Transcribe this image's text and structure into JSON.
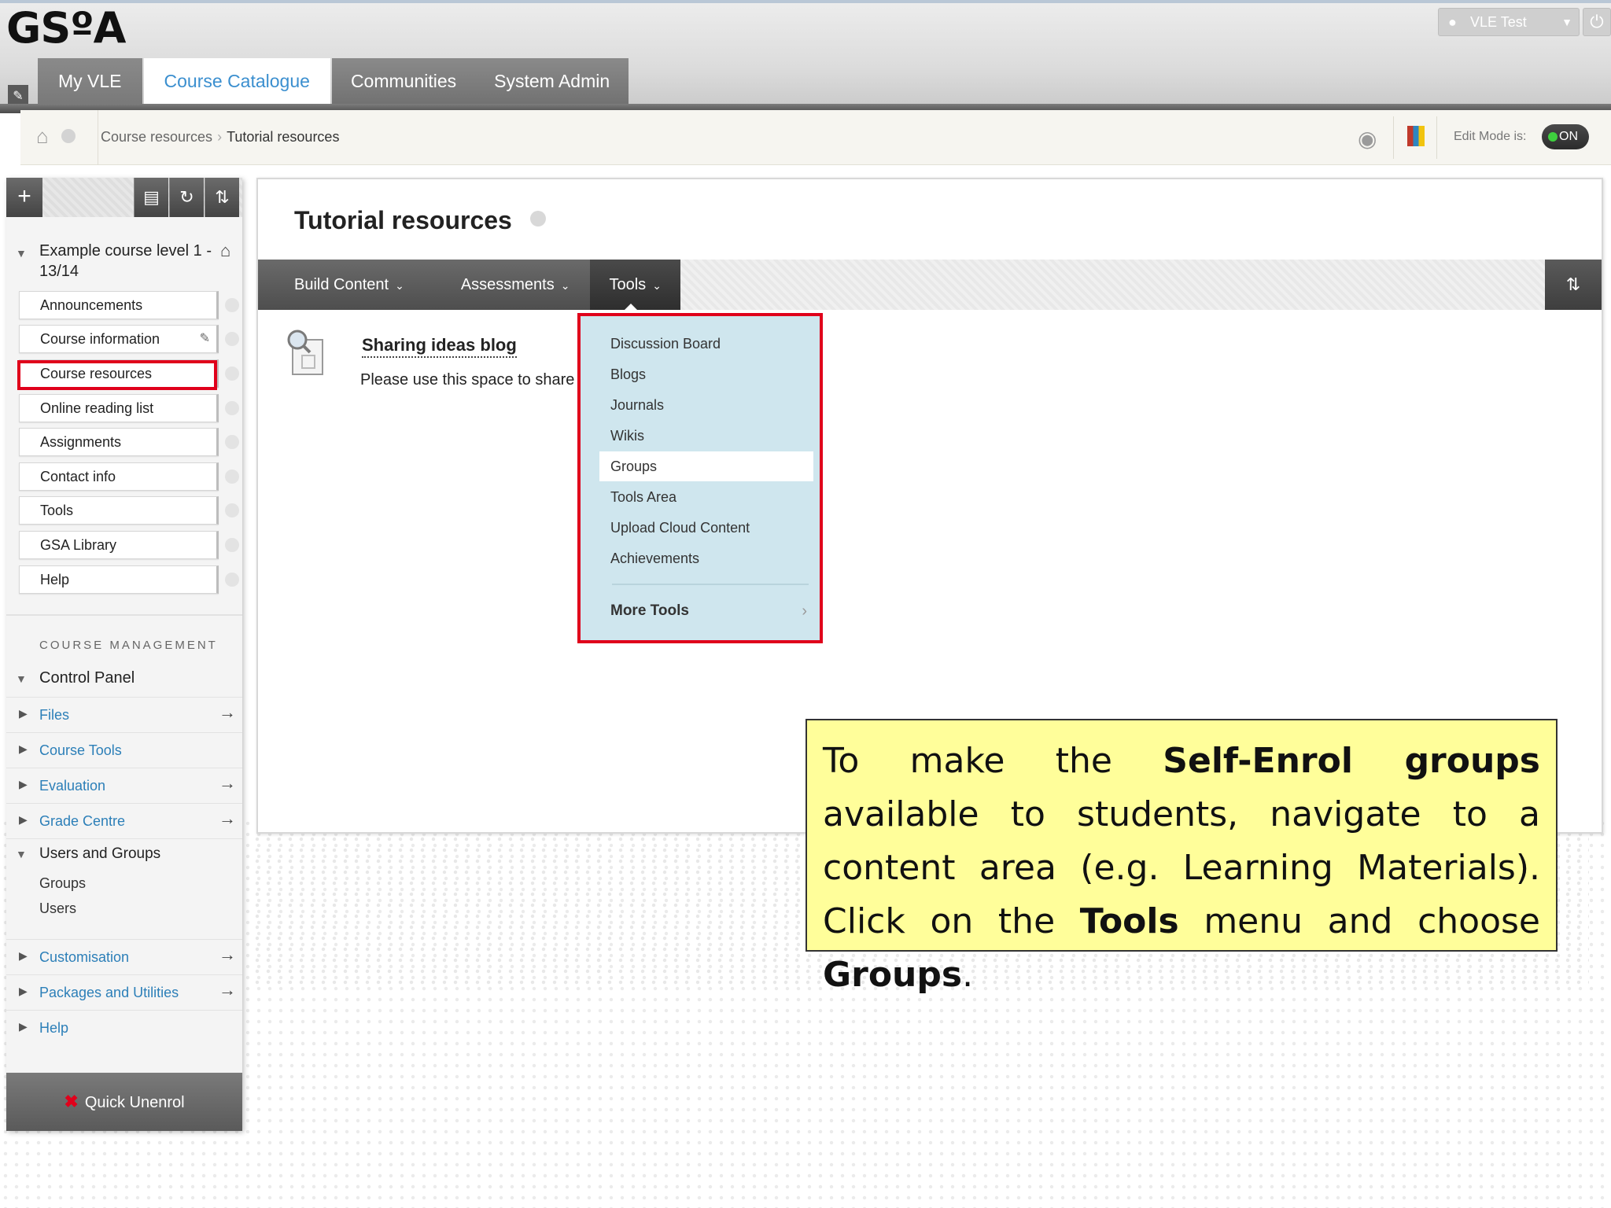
{
  "header": {
    "logo": "GSºA",
    "user": "VLE Test",
    "tabs": [
      "My VLE",
      "Course Catalogue",
      "Communities",
      "System Admin"
    ],
    "active_tab": "Course Catalogue"
  },
  "breadcrumb": {
    "items": [
      "Course resources",
      "Tutorial resources"
    ],
    "separator": "›",
    "edit_mode_label": "Edit Mode is:",
    "edit_mode_value": "ON"
  },
  "left_menu": {
    "course_title": "Example course level 1 - 13/14",
    "items": [
      "Announcements",
      "Course information",
      "Course resources",
      "Online reading list",
      "Assignments",
      "Contact info",
      "Tools",
      "GSA Library",
      "Help"
    ],
    "highlighted_item": "Course resources",
    "course_management_header": "COURSE MANAGEMENT",
    "control_panel_label": "Control Panel",
    "control_panel_items": [
      {
        "label": "Files",
        "arrow": "→"
      },
      {
        "label": "Course Tools",
        "arrow": ""
      },
      {
        "label": "Evaluation",
        "arrow": "→"
      },
      {
        "label": "Grade Centre",
        "arrow": "→"
      }
    ],
    "users_groups_label": "Users and Groups",
    "users_groups_items": [
      "Groups",
      "Users"
    ],
    "lower_items": [
      {
        "label": "Customisation",
        "arrow": "→"
      },
      {
        "label": "Packages and Utilities",
        "arrow": "→"
      },
      {
        "label": "Help",
        "arrow": ""
      }
    ],
    "quick_unenrol": "Quick Unenrol"
  },
  "content": {
    "title": "Tutorial resources",
    "actions": [
      "Build Content",
      "Assessments",
      "Tools"
    ],
    "blog_title": "Sharing ideas blog",
    "blog_description": "Please use this space to share"
  },
  "tools_menu": {
    "items": [
      "Discussion Board",
      "Blogs",
      "Journals",
      "Wikis",
      "Groups",
      "Tools Area",
      "Upload Cloud Content",
      "Achievements"
    ],
    "selected": "Groups",
    "more": "More Tools"
  },
  "callout": {
    "p1": "To make the ",
    "b1": "Self-Enrol groups",
    "p2": " available to students, navigate to a content area (e.g. Learning Materials). Click on the ",
    "b2": "Tools",
    "p3": " menu and choose ",
    "b3": "Groups",
    "p4": "."
  },
  "colors": {
    "accent_blue": "#3b8fcf",
    "highlight_red": "#e0001b",
    "dropdown_bg": "#cfe6ee",
    "callout_bg": "#fffe9a"
  }
}
